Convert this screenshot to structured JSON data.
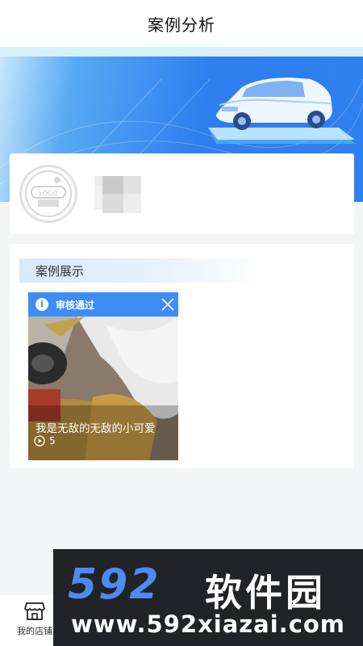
{
  "header": {
    "title": "案例分析"
  },
  "shop": {
    "logo_text": "LOGO"
  },
  "cases_section": {
    "title": "案例展示",
    "items": [
      {
        "status": "审核通过",
        "title": "我是无敌的无敌的小可爱",
        "play_count": "5"
      }
    ]
  },
  "tabbar": {
    "items": [
      {
        "label": "我的店铺",
        "icon": "store-icon"
      }
    ]
  },
  "watermark": {
    "brand_num": "592",
    "brand_cn": "软件园",
    "url": "www.592xiazai.com"
  },
  "colors": {
    "accent": "#3d8df5",
    "banner": "#2f80ef",
    "watermark_blue": "#4d8af3"
  }
}
